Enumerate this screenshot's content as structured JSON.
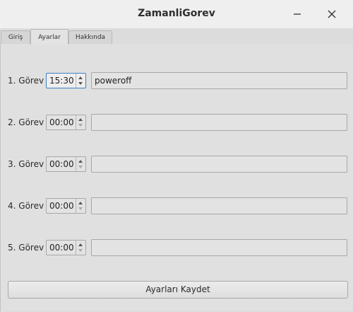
{
  "window": {
    "title": "ZamanliGorev"
  },
  "tabs": [
    {
      "label": "Giriş",
      "active": false
    },
    {
      "label": "Ayarlar",
      "active": true
    },
    {
      "label": "Hakkında",
      "active": false
    }
  ],
  "tasks": [
    {
      "label": "1. Görev",
      "time": "15:30",
      "command": "poweroff"
    },
    {
      "label": "2. Görev",
      "time": "00:00",
      "command": ""
    },
    {
      "label": "3. Görev",
      "time": "00:00",
      "command": ""
    },
    {
      "label": "4. Görev",
      "time": "00:00",
      "command": ""
    },
    {
      "label": "5. Görev",
      "time": "00:00",
      "command": ""
    }
  ],
  "save_button": {
    "label": "Ayarları Kaydet"
  },
  "icons": {
    "minimize": "minimize-icon",
    "close": "close-icon"
  }
}
